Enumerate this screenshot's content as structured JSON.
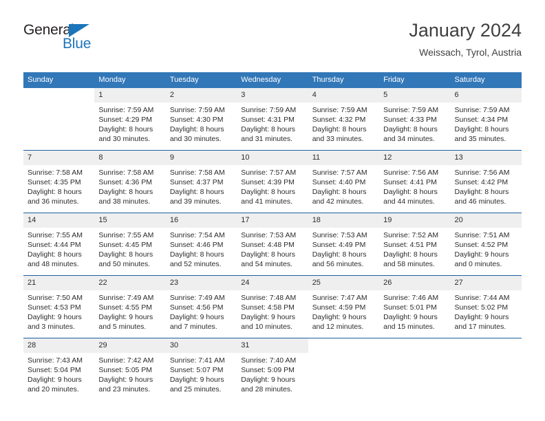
{
  "brand": {
    "name_part1": "General",
    "name_part2": "Blue",
    "accent_color": "#1b75bb"
  },
  "header": {
    "title": "January 2024",
    "subtitle": "Weissach, Tyrol, Austria"
  },
  "calendar": {
    "header_color": "#3277b8",
    "weekdays": [
      "Sunday",
      "Monday",
      "Tuesday",
      "Wednesday",
      "Thursday",
      "Friday",
      "Saturday"
    ],
    "weeks": [
      [
        {
          "day": "",
          "lines": []
        },
        {
          "day": "1",
          "lines": [
            "Sunrise: 7:59 AM",
            "Sunset: 4:29 PM",
            "Daylight: 8 hours",
            "and 30 minutes."
          ]
        },
        {
          "day": "2",
          "lines": [
            "Sunrise: 7:59 AM",
            "Sunset: 4:30 PM",
            "Daylight: 8 hours",
            "and 30 minutes."
          ]
        },
        {
          "day": "3",
          "lines": [
            "Sunrise: 7:59 AM",
            "Sunset: 4:31 PM",
            "Daylight: 8 hours",
            "and 31 minutes."
          ]
        },
        {
          "day": "4",
          "lines": [
            "Sunrise: 7:59 AM",
            "Sunset: 4:32 PM",
            "Daylight: 8 hours",
            "and 33 minutes."
          ]
        },
        {
          "day": "5",
          "lines": [
            "Sunrise: 7:59 AM",
            "Sunset: 4:33 PM",
            "Daylight: 8 hours",
            "and 34 minutes."
          ]
        },
        {
          "day": "6",
          "lines": [
            "Sunrise: 7:59 AM",
            "Sunset: 4:34 PM",
            "Daylight: 8 hours",
            "and 35 minutes."
          ]
        }
      ],
      [
        {
          "day": "7",
          "lines": [
            "Sunrise: 7:58 AM",
            "Sunset: 4:35 PM",
            "Daylight: 8 hours",
            "and 36 minutes."
          ]
        },
        {
          "day": "8",
          "lines": [
            "Sunrise: 7:58 AM",
            "Sunset: 4:36 PM",
            "Daylight: 8 hours",
            "and 38 minutes."
          ]
        },
        {
          "day": "9",
          "lines": [
            "Sunrise: 7:58 AM",
            "Sunset: 4:37 PM",
            "Daylight: 8 hours",
            "and 39 minutes."
          ]
        },
        {
          "day": "10",
          "lines": [
            "Sunrise: 7:57 AM",
            "Sunset: 4:39 PM",
            "Daylight: 8 hours",
            "and 41 minutes."
          ]
        },
        {
          "day": "11",
          "lines": [
            "Sunrise: 7:57 AM",
            "Sunset: 4:40 PM",
            "Daylight: 8 hours",
            "and 42 minutes."
          ]
        },
        {
          "day": "12",
          "lines": [
            "Sunrise: 7:56 AM",
            "Sunset: 4:41 PM",
            "Daylight: 8 hours",
            "and 44 minutes."
          ]
        },
        {
          "day": "13",
          "lines": [
            "Sunrise: 7:56 AM",
            "Sunset: 4:42 PM",
            "Daylight: 8 hours",
            "and 46 minutes."
          ]
        }
      ],
      [
        {
          "day": "14",
          "lines": [
            "Sunrise: 7:55 AM",
            "Sunset: 4:44 PM",
            "Daylight: 8 hours",
            "and 48 minutes."
          ]
        },
        {
          "day": "15",
          "lines": [
            "Sunrise: 7:55 AM",
            "Sunset: 4:45 PM",
            "Daylight: 8 hours",
            "and 50 minutes."
          ]
        },
        {
          "day": "16",
          "lines": [
            "Sunrise: 7:54 AM",
            "Sunset: 4:46 PM",
            "Daylight: 8 hours",
            "and 52 minutes."
          ]
        },
        {
          "day": "17",
          "lines": [
            "Sunrise: 7:53 AM",
            "Sunset: 4:48 PM",
            "Daylight: 8 hours",
            "and 54 minutes."
          ]
        },
        {
          "day": "18",
          "lines": [
            "Sunrise: 7:53 AM",
            "Sunset: 4:49 PM",
            "Daylight: 8 hours",
            "and 56 minutes."
          ]
        },
        {
          "day": "19",
          "lines": [
            "Sunrise: 7:52 AM",
            "Sunset: 4:51 PM",
            "Daylight: 8 hours",
            "and 58 minutes."
          ]
        },
        {
          "day": "20",
          "lines": [
            "Sunrise: 7:51 AM",
            "Sunset: 4:52 PM",
            "Daylight: 9 hours",
            "and 0 minutes."
          ]
        }
      ],
      [
        {
          "day": "21",
          "lines": [
            "Sunrise: 7:50 AM",
            "Sunset: 4:53 PM",
            "Daylight: 9 hours",
            "and 3 minutes."
          ]
        },
        {
          "day": "22",
          "lines": [
            "Sunrise: 7:49 AM",
            "Sunset: 4:55 PM",
            "Daylight: 9 hours",
            "and 5 minutes."
          ]
        },
        {
          "day": "23",
          "lines": [
            "Sunrise: 7:49 AM",
            "Sunset: 4:56 PM",
            "Daylight: 9 hours",
            "and 7 minutes."
          ]
        },
        {
          "day": "24",
          "lines": [
            "Sunrise: 7:48 AM",
            "Sunset: 4:58 PM",
            "Daylight: 9 hours",
            "and 10 minutes."
          ]
        },
        {
          "day": "25",
          "lines": [
            "Sunrise: 7:47 AM",
            "Sunset: 4:59 PM",
            "Daylight: 9 hours",
            "and 12 minutes."
          ]
        },
        {
          "day": "26",
          "lines": [
            "Sunrise: 7:46 AM",
            "Sunset: 5:01 PM",
            "Daylight: 9 hours",
            "and 15 minutes."
          ]
        },
        {
          "day": "27",
          "lines": [
            "Sunrise: 7:44 AM",
            "Sunset: 5:02 PM",
            "Daylight: 9 hours",
            "and 17 minutes."
          ]
        }
      ],
      [
        {
          "day": "28",
          "lines": [
            "Sunrise: 7:43 AM",
            "Sunset: 5:04 PM",
            "Daylight: 9 hours",
            "and 20 minutes."
          ]
        },
        {
          "day": "29",
          "lines": [
            "Sunrise: 7:42 AM",
            "Sunset: 5:05 PM",
            "Daylight: 9 hours",
            "and 23 minutes."
          ]
        },
        {
          "day": "30",
          "lines": [
            "Sunrise: 7:41 AM",
            "Sunset: 5:07 PM",
            "Daylight: 9 hours",
            "and 25 minutes."
          ]
        },
        {
          "day": "31",
          "lines": [
            "Sunrise: 7:40 AM",
            "Sunset: 5:09 PM",
            "Daylight: 9 hours",
            "and 28 minutes."
          ]
        },
        {
          "day": "",
          "lines": []
        },
        {
          "day": "",
          "lines": []
        },
        {
          "day": "",
          "lines": []
        }
      ]
    ]
  }
}
